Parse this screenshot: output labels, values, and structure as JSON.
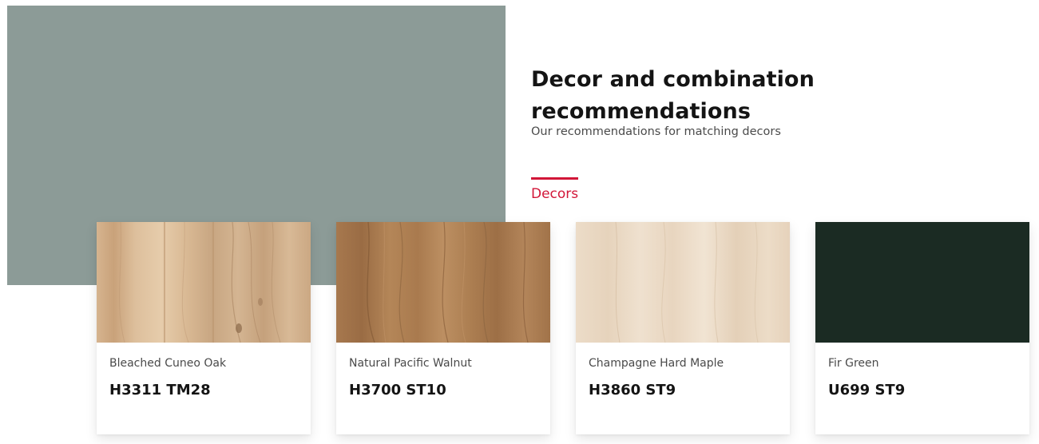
{
  "hero": {
    "swatch_color": "#8c9b97"
  },
  "intro": {
    "title": "Decor and combination recommendations",
    "subtitle": "Our recommendations for matching decors"
  },
  "tabs": {
    "active_label": "Decors",
    "accent_color": "#d21638"
  },
  "decors": [
    {
      "name": "Bleached Cuneo Oak",
      "code": "H3311 TM28",
      "texture": "light-oak-wood"
    },
    {
      "name": "Natural Pacific Walnut",
      "code": "H3700 ST10",
      "texture": "walnut-wood"
    },
    {
      "name": "Champagne Hard Maple",
      "code": "H3860 ST9",
      "texture": "maple-wood"
    },
    {
      "name": "Fir Green",
      "code": "U699 ST9",
      "texture": "solid-dark-green"
    }
  ]
}
